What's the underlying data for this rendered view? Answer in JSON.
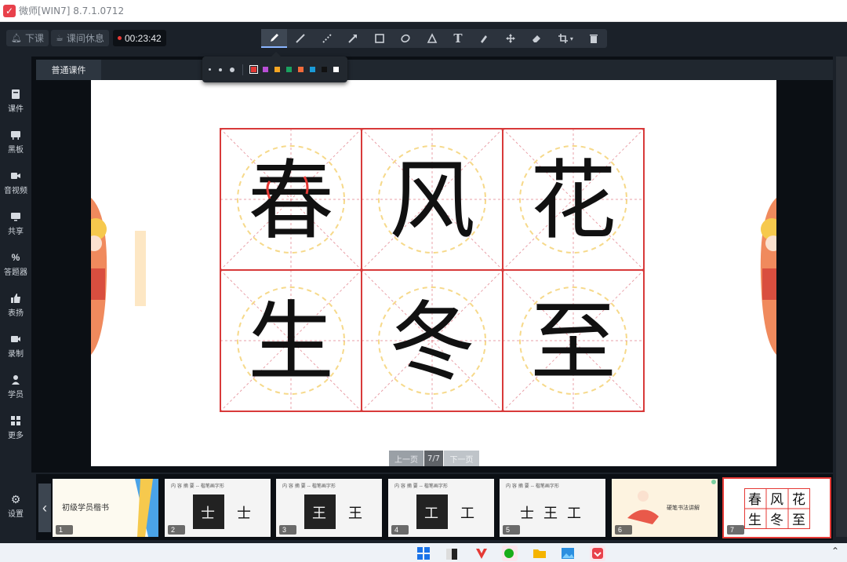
{
  "window": {
    "title": "微师[WIN7] 8.7.1.0712"
  },
  "topbar": {
    "end_class_label": "下课",
    "break_label": "课间休息",
    "timer": "00:23:42"
  },
  "tools": [
    "pen-icon",
    "line-icon",
    "dashed-line-icon",
    "arrow-icon",
    "rectangle-icon",
    "ellipse-icon",
    "triangle-icon",
    "text-icon",
    "highlighter-icon",
    "move-icon",
    "eraser-icon",
    "crop-icon",
    "trash-icon"
  ],
  "tool_text_glyph": "T",
  "palette": {
    "colors": [
      "#e53935",
      "#b84fd6",
      "#f5a623",
      "#1aa260",
      "#f26b3a",
      "#1a9bd7",
      "#111111",
      "#ffffff"
    ],
    "selected": "#e53935"
  },
  "sidebar": {
    "items": [
      {
        "label": "课件",
        "icon": "courseware-icon"
      },
      {
        "label": "黑板",
        "icon": "blackboard-icon"
      },
      {
        "label": "音视频",
        "icon": "media-icon"
      },
      {
        "label": "共享",
        "icon": "share-screen-icon"
      },
      {
        "label": "答题器",
        "icon": "quiz-icon"
      },
      {
        "label": "表扬",
        "icon": "thumbs-up-icon"
      },
      {
        "label": "录制",
        "icon": "record-icon"
      },
      {
        "label": "学员",
        "icon": "students-icon"
      },
      {
        "label": "更多",
        "icon": "more-icon"
      },
      {
        "label": "设置",
        "icon": "settings-icon"
      }
    ]
  },
  "stage": {
    "tab_label": "普通课件",
    "characters": [
      "春",
      "风",
      "花",
      "生",
      "冬",
      "至"
    ],
    "prev_label": "上一页",
    "page_indicator": "7/7",
    "next_label": "下一页"
  },
  "thumbnails": [
    {
      "num": "1",
      "title": "初级学员楷书"
    },
    {
      "num": "2",
      "title": "内 容 摘 要 -- 楷笔画字形",
      "chars": [
        "士",
        "士"
      ]
    },
    {
      "num": "3",
      "title": "内 容 摘 要 -- 楷笔画字形",
      "chars": [
        "王",
        "王"
      ]
    },
    {
      "num": "4",
      "title": "内 容 摘 要 -- 楷笔画字形",
      "chars": [
        "工",
        "工"
      ]
    },
    {
      "num": "5",
      "title": "内 容 摘 要 -- 楷笔画字形",
      "chars": [
        "士",
        "王",
        "工"
      ]
    },
    {
      "num": "6",
      "title": "硬笔书法讲解"
    },
    {
      "num": "7",
      "chars": [
        "春",
        "风",
        "花",
        "生",
        "冬",
        "至"
      ]
    }
  ]
}
